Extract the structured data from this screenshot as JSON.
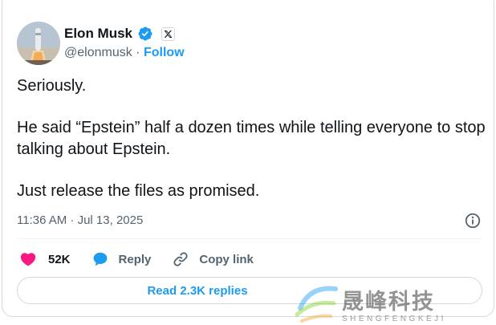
{
  "quote": {
    "stub_text": "Just release the files as promised..."
  },
  "author": {
    "name": "Elon Musk",
    "handle": "@elonmusk",
    "separator": "·",
    "follow_label": "Follow",
    "verified_color": "#1d9bf0",
    "avatar_icon": "starship-launch-avatar",
    "affiliation_icon": "x-logo-icon"
  },
  "tweet": {
    "lines": [
      "Seriously.",
      "He said “Epstein” half a dozen times while telling everyone to stop talking about Epstein.",
      "Just release the files as promised."
    ],
    "timestamp": "11:36 AM · Jul 13, 2025",
    "info_icon": "info-icon"
  },
  "actions": {
    "like_count": "52K",
    "like_icon": "heart-icon",
    "like_color": "#f91880",
    "reply_label": "Reply",
    "reply_icon": "speech-bubble-icon",
    "reply_color": "#1d9bf0",
    "copy_label": "Copy link",
    "copy_icon": "link-icon"
  },
  "replies_button": {
    "label": "Read 2.3K replies"
  },
  "watermark": {
    "text": "晟峰科技",
    "subtext": "SHENGFENGKEJI"
  },
  "colors": {
    "accent": "#1d9bf0",
    "text_primary": "#0f1419",
    "text_secondary": "#536471",
    "border": "#cfd9de"
  }
}
